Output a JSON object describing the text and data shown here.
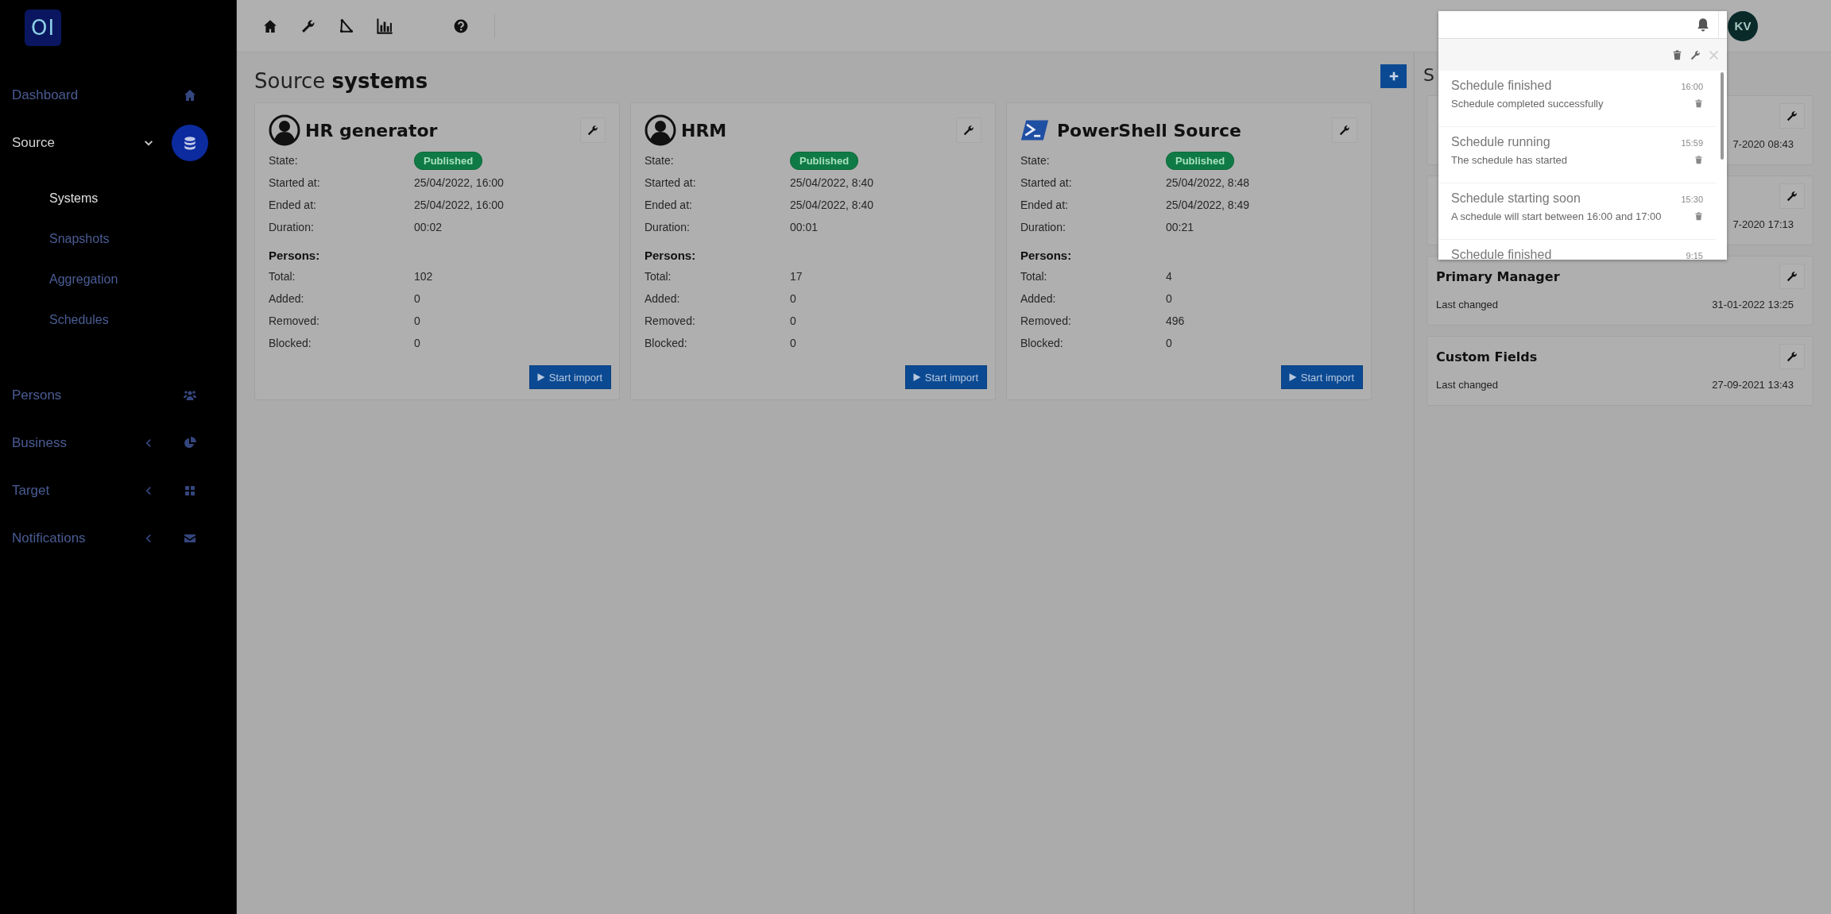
{
  "logo": "OI",
  "sidebar": {
    "items": [
      {
        "label": "Dashboard",
        "kind": "link",
        "selected": false
      },
      {
        "label": "Source",
        "kind": "group",
        "selected": true,
        "expanded": true,
        "children": [
          {
            "label": "Systems",
            "selected": true
          },
          {
            "label": "Snapshots",
            "selected": false
          },
          {
            "label": "Aggregation",
            "selected": false
          },
          {
            "label": "Schedules",
            "selected": false
          }
        ]
      },
      {
        "label": "Persons",
        "kind": "link",
        "selected": false
      },
      {
        "label": "Business",
        "kind": "group",
        "selected": false,
        "expanded": false
      },
      {
        "label": "Target",
        "kind": "group",
        "selected": false,
        "expanded": false
      },
      {
        "label": "Notifications",
        "kind": "group",
        "selected": false,
        "expanded": false
      }
    ]
  },
  "page_title": "Source **systems**",
  "cards": [
    {
      "title": "HR generator",
      "kind": "person",
      "state_label": "State:",
      "state": "Published",
      "fields": [
        {
          "label": "Started at:",
          "value": "25/04/2022, 16:00"
        },
        {
          "label": "Ended at:",
          "value": "25/04/2022, 16:00"
        },
        {
          "label": "Duration:",
          "value": "00:02"
        }
      ],
      "section": "Persons:",
      "persons": [
        {
          "label": "Total:",
          "value": "102"
        },
        {
          "label": "Added:",
          "value": "0"
        },
        {
          "label": "Removed:",
          "value": "0"
        },
        {
          "label": "Blocked:",
          "value": "0"
        }
      ],
      "button": "Start import"
    },
    {
      "title": "HRM",
      "kind": "person",
      "state_label": "State:",
      "state": "Published",
      "fields": [
        {
          "label": "Started at:",
          "value": "25/04/2022, 8:40"
        },
        {
          "label": "Ended at:",
          "value": "25/04/2022, 8:40"
        },
        {
          "label": "Duration:",
          "value": "00:01"
        }
      ],
      "section": "Persons:",
      "persons": [
        {
          "label": "Total:",
          "value": "17"
        },
        {
          "label": "Added:",
          "value": "0"
        },
        {
          "label": "Removed:",
          "value": "0"
        },
        {
          "label": "Blocked:",
          "value": "0"
        }
      ],
      "button": "Start import"
    },
    {
      "title": "PowerShell Source",
      "kind": "powershell",
      "state_label": "State:",
      "state": "Published",
      "fields": [
        {
          "label": "Started at:",
          "value": "25/04/2022, 8:48"
        },
        {
          "label": "Ended at:",
          "value": "25/04/2022, 8:49"
        },
        {
          "label": "Duration:",
          "value": "00:21"
        }
      ],
      "section": "Persons:",
      "persons": [
        {
          "label": "Total:",
          "value": "4"
        },
        {
          "label": "Added:",
          "value": "0"
        },
        {
          "label": "Removed:",
          "value": "496"
        },
        {
          "label": "Blocked:",
          "value": "0"
        }
      ],
      "button": "Start import"
    }
  ],
  "right_panel": {
    "heading": "S",
    "cards": [
      {
        "value": "7-2020 08:43"
      },
      {
        "value": "7-2020 17:13"
      },
      {
        "title": "Primary Manager",
        "label": "Last changed",
        "value": "31-01-2022 13:25"
      },
      {
        "title": "Custom Fields",
        "label": "Last changed",
        "value": "27-09-2021 13:43"
      }
    ]
  },
  "user": {
    "initials": "KV"
  },
  "notifications": [
    {
      "title": "Schedule finished",
      "time": "16:00",
      "message": "Schedule completed successfully"
    },
    {
      "title": "Schedule running",
      "time": "15:59",
      "message": "The schedule has started"
    },
    {
      "title": "Schedule starting soon",
      "time": "15:30",
      "message": "A schedule will start between 16:00 and 17:00"
    },
    {
      "title": "Schedule finished",
      "time": "9:15"
    }
  ]
}
